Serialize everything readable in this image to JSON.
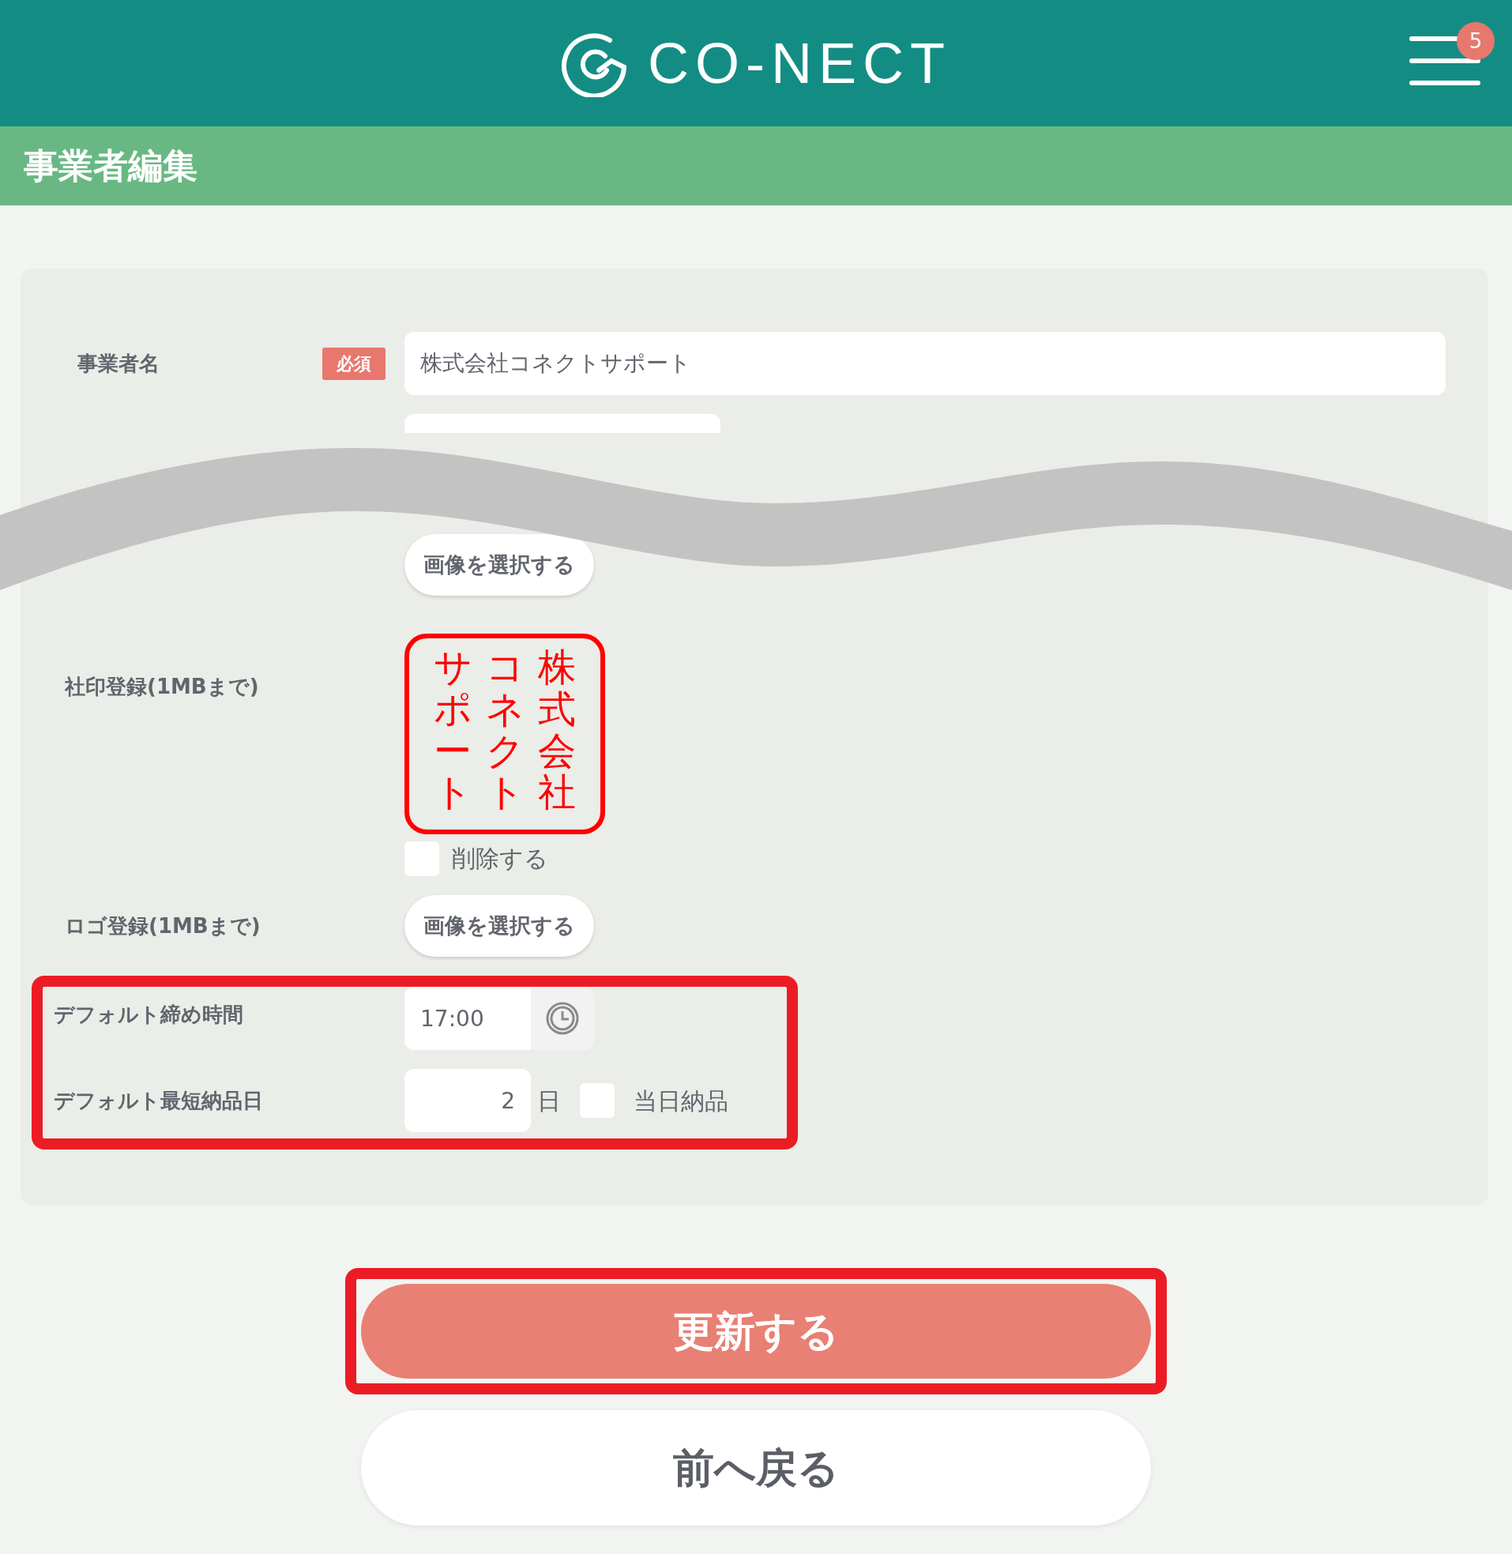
{
  "header": {
    "logo_text": "CO-NECT",
    "notification_count": "5"
  },
  "page_title": "事業者編集",
  "business_name": {
    "label": "事業者名",
    "badge": "必須",
    "value": "株式会社コネクトサポート"
  },
  "first_image_button": "画像を選択する",
  "seal": {
    "label": "社印登録(1MBまで)",
    "stamp_columns": [
      "サポート",
      "コネクト",
      "株式会社"
    ],
    "delete": {
      "label": "削除する",
      "checked": false
    }
  },
  "logo": {
    "label": "ロゴ登録(1MBまで)",
    "button": "画像を選択する"
  },
  "defaults": {
    "highlighted": true,
    "cutoff": {
      "label": "デフォルト締め時間",
      "value": "17:00"
    },
    "lead_days": {
      "label": "デフォルト最短納品日",
      "value": "2",
      "unit": "日",
      "same_day": {
        "label": "当日納品",
        "checked": false
      }
    }
  },
  "actions": [
    {
      "label": "更新する",
      "kind": "primary",
      "highlighted": true
    },
    {
      "label": "前へ戻る",
      "kind": "secondary",
      "highlighted": false
    }
  ]
}
